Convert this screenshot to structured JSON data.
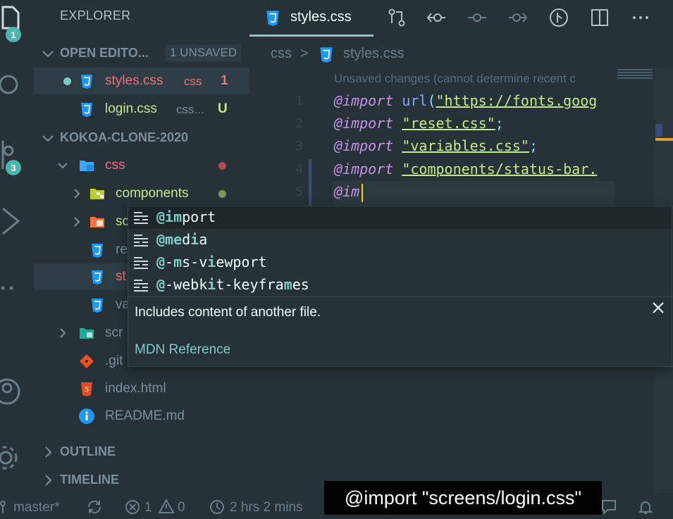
{
  "activity": {
    "explorer_badge": "1",
    "scm_badge": "3"
  },
  "sidebar": {
    "title": "EXPLORER",
    "open_editors": {
      "label": "OPEN EDITO...",
      "badge": "1 UNSAVED"
    },
    "open_files": [
      {
        "name": "styles.css",
        "tag": "css",
        "status": "1"
      },
      {
        "name": "login.css",
        "tag": "css...",
        "status": "U"
      }
    ],
    "project": "KOKOA-CLONE-2020",
    "tree": {
      "css": "css",
      "components": "components",
      "screens": "sc",
      "reset": "re",
      "styles": "st",
      "variables": "va",
      "scripts": "scr",
      "gitignore": ".git",
      "index": "index.html",
      "readme": "README.md"
    },
    "outline": "OUTLINE",
    "timeline": "TIMELINE"
  },
  "tabs": {
    "active": "styles.css"
  },
  "breadcrumb": {
    "folder": "css",
    "sep": ">",
    "file": "styles.css"
  },
  "editor": {
    "hint": "Unsaved changes (cannot determine recent c",
    "line_numbers": [
      "1",
      "2",
      "3",
      "4",
      "5"
    ],
    "lines": [
      {
        "kw": "@import",
        "fn": "url",
        "open": "(",
        "str": "\"https://fonts.goog"
      },
      {
        "kw": "@import",
        "str": "\"reset.css\"",
        "end": ";"
      },
      {
        "kw": "@import",
        "str": "\"variables.css\"",
        "end": ";"
      },
      {
        "kw": "@import",
        "str": "\"components/status-bar."
      },
      {
        "typed": "@im"
      }
    ]
  },
  "suggest": {
    "items": [
      {
        "match1": "@im",
        "rest": "port"
      },
      {
        "match1": "@me",
        "mid": "d",
        "match2": "i",
        "rest": "a"
      },
      {
        "match1": "@",
        "mid": "-",
        "match2": "m",
        "mid2": "s-v",
        "match3": "i",
        "rest": "ewport"
      },
      {
        "match1": "@",
        "mid": "-webk",
        "match2": "i",
        "mid2": "t-keyfra",
        "match3": "m",
        "rest": "es"
      }
    ],
    "description": "Includes content of another file.",
    "link": "MDN Reference"
  },
  "status": {
    "branch": "master*",
    "errors": "1",
    "warnings": "0",
    "time": "2 hrs 2 mins"
  },
  "caption": "@import \"screens/login.css\"",
  "colors": {
    "background": "#263238",
    "accent": "#80cbc4",
    "modified": "#f07178",
    "untracked": "#c3e88d",
    "css_icon": "#2196f3"
  }
}
